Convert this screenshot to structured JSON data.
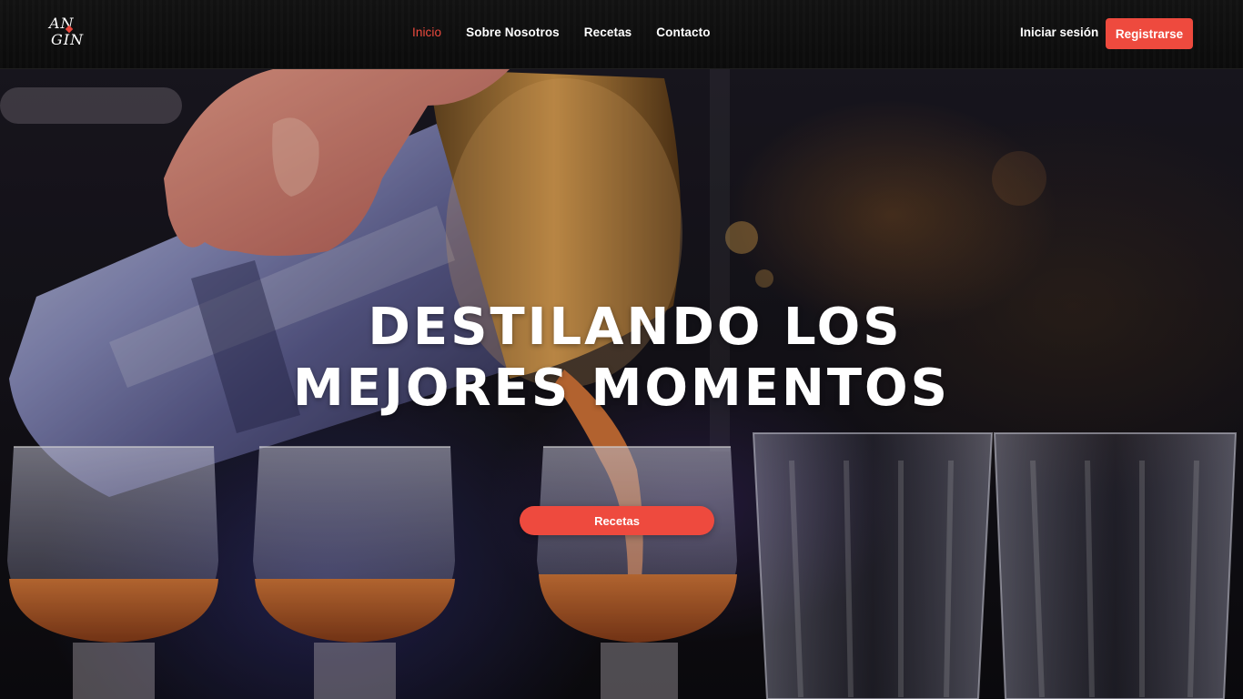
{
  "brand": {
    "logo_line1": "AN",
    "logo_line2": "GIN"
  },
  "nav": {
    "items": [
      {
        "label": "Inicio",
        "active": true
      },
      {
        "label": "Sobre Nosotros",
        "active": false
      },
      {
        "label": "Recetas",
        "active": false
      },
      {
        "label": "Contacto",
        "active": false
      }
    ],
    "login_label": "Iniciar sesión",
    "register_label": "Registrarse"
  },
  "hero": {
    "title_line1": "Destilando los",
    "title_line2": "mejores momentos",
    "cta_label": "Recetas",
    "image_icon": "bartender-pouring-cocktail-photo"
  },
  "colors": {
    "accent": "#ee4a3e",
    "navbar": "#0f0f0f",
    "text": "#ffffff"
  }
}
